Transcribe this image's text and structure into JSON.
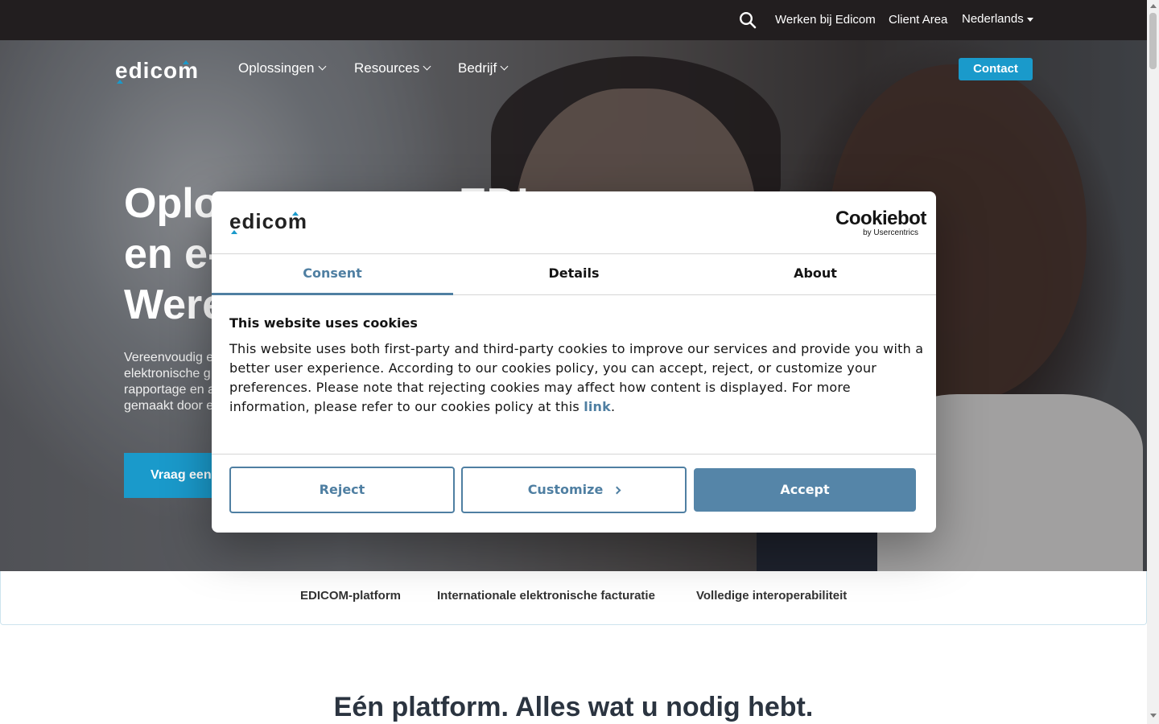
{
  "topbar": {
    "search_icon": "search-icon",
    "links": [
      "Werken bij Edicom",
      "Client Area",
      "Nederlands"
    ]
  },
  "nav": {
    "logo_text": "edicom",
    "menu": [
      "Oplossingen",
      "Resources",
      "Bedrijf"
    ],
    "contact_label": "Contact"
  },
  "hero": {
    "title_lines": [
      "Oplo",
      "en e-",
      "Were"
    ],
    "title_right": "EDI",
    "text_lines": [
      "Vereenvoudig e",
      "elektronische g",
      "rapportage en a",
      "gemaakt door e"
    ],
    "button_label": "Vraag een"
  },
  "subnav": {
    "items": [
      "EDICOM-platform",
      "Internationale elektronische facturatie",
      "Volledige interoperabiliteit"
    ]
  },
  "section": {
    "title": "Eén platform. Alles wat u nodig hebt."
  },
  "cookie_dialog": {
    "logo_text": "edicom",
    "brand_name": "Cookiebot",
    "brand_sub": "by Usercentrics",
    "tabs": [
      "Consent",
      "Details",
      "About"
    ],
    "active_tab": "Consent",
    "heading": "This website uses cookies",
    "body_lines": [
      "This website uses both first-party and third-party cookies to improve our services and provide you with a",
      "better user experience. According to our cookies policy, you can accept, reject, or customize your",
      "preferences. Please note that rejecting cookies may affect how content is displayed. For more",
      "information, please refer to our cookies policy at this"
    ],
    "link_text": "link",
    "period": ".",
    "buttons": {
      "reject": "Reject",
      "customize": "Customize",
      "accept": "Accept"
    }
  },
  "colors": {
    "topbar": "#221e1f",
    "brand_blue": "#1a9acb",
    "dialog_accent": "#4f7fa2",
    "accept_fill": "#5585a8"
  }
}
